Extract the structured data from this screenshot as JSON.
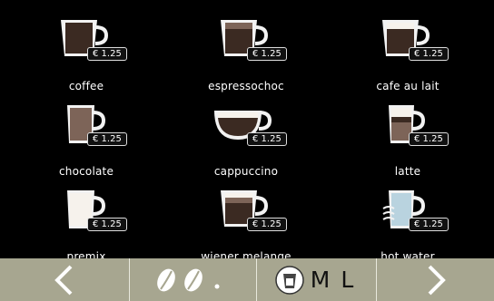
{
  "drinks": [
    {
      "name": "coffee",
      "price": "€ 1.25",
      "cup": "mug",
      "icon": "coffee-cup-icon"
    },
    {
      "name": "espressochoc",
      "price": "€ 1.25",
      "cup": "mug",
      "icon": "espressochoc-cup-icon"
    },
    {
      "name": "cafe au lait",
      "price": "€ 1.25",
      "cup": "mug",
      "icon": "cafe-au-lait-cup-icon"
    },
    {
      "name": "chocolate",
      "price": "€ 1.25",
      "cup": "tall",
      "icon": "chocolate-cup-icon"
    },
    {
      "name": "cappuccino",
      "price": "€ 1.25",
      "cup": "wide",
      "icon": "cappuccino-cup-icon"
    },
    {
      "name": "latte",
      "price": "€ 1.25",
      "cup": "glass",
      "icon": "latte-glass-icon"
    },
    {
      "name": "premix",
      "price": "€ 1.25",
      "cup": "tall",
      "icon": "premix-cup-icon"
    },
    {
      "name": "wiener melange",
      "price": "€ 1.25",
      "cup": "mug",
      "icon": "wiener-melange-cup-icon"
    },
    {
      "name": "hot water",
      "price": "€ 1.25",
      "cup": "glass",
      "icon": "hot-water-glass-icon"
    }
  ],
  "bottom_bar": {
    "prev_icon": "chevron-left-icon",
    "next_icon": "chevron-right-icon",
    "strength_icon": "coffee-bean-icon",
    "cup_icon": "cup-select-icon",
    "size_medium": "M",
    "size_large": "L"
  },
  "colors": {
    "background": "#000000",
    "bar": "#a7a690",
    "cup_white": "#f2f2f2",
    "coffee": "#3b2a22",
    "chocolate": "#7d6458",
    "milk": "#f6f2ec",
    "water": "#b9d3df"
  }
}
